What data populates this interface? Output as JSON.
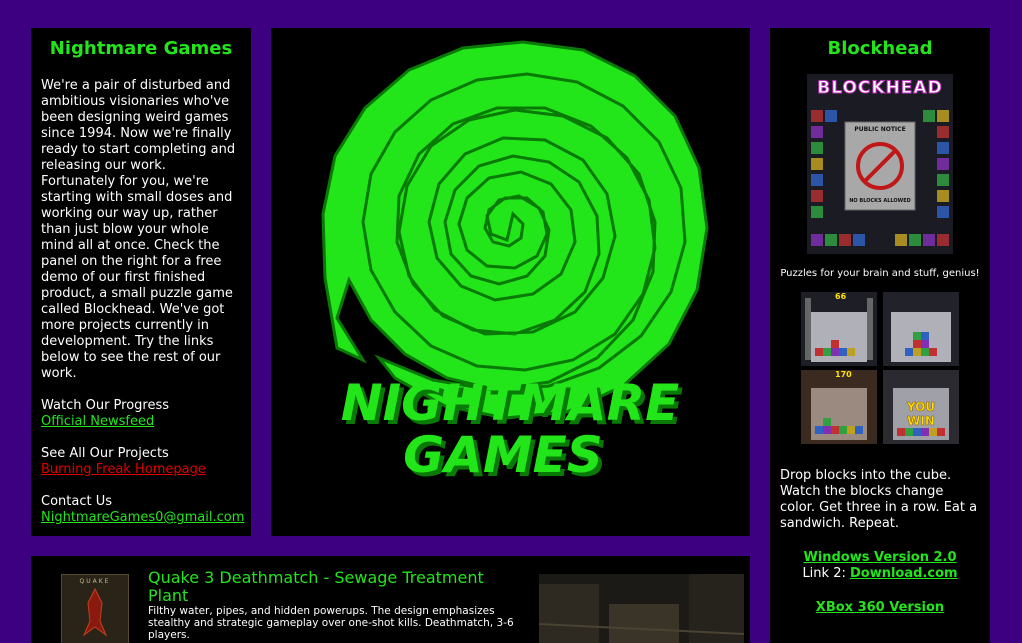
{
  "left": {
    "title": "Nightmare Games",
    "intro": "We're a pair of disturbed and ambitious visionaries who've been designing weird games since 1994. Now we're finally ready to start completing and releasing our work. Fortunately for you, we're starting with small doses and working our way up, rather than just blow your whole mind all at once. Check the panel on the right for a free demo of our first finished product, a small puzzle game called Blockhead. We've got more projects currently in development. Try the links below to see the rest of our work.",
    "progress_label": "Watch Our Progress",
    "progress_link": "Official Newsfeed",
    "projects_label": "See All Our Projects",
    "projects_link": "Burning Freak Homepage",
    "contact_label": "Contact Us",
    "contact_link": "NightmareGames0@gmail.com"
  },
  "logo": {
    "line1": "NIGHTMARE",
    "line2": "GAMES"
  },
  "right": {
    "title": "Blockhead",
    "box_title": "BLOCKHEAD",
    "notice_title": "PUBLIC NOTICE",
    "notice_text": "NO BLOCKS ALLOWED",
    "tagline": "Puzzles for your brain and stuff, genius!",
    "shot_labels": [
      "66",
      "",
      "170",
      "YOU WIN"
    ],
    "description": "Drop blocks into the cube. Watch the blocks change color. Get three in a row. Eat a sandwich. Repeat.",
    "windows_link": "Windows Version 2.0",
    "link2_label": "Link 2:",
    "download_link": "Download.com",
    "xbox_link": "XBox 360 Version"
  },
  "bottom": {
    "box_label": "QUAKE",
    "title": "Quake 3 Deathmatch - Sewage Treatment Plant",
    "description": "Filthy water, pipes, and hidden powerups. The design emphasizes stealthy and strategic gameplay over one-shot kills. Deathmatch, 3-6 players."
  },
  "colors": {
    "background": "#3d0080",
    "accent_green": "#22e51a",
    "link_red": "#e00000",
    "panel": "#000000"
  }
}
